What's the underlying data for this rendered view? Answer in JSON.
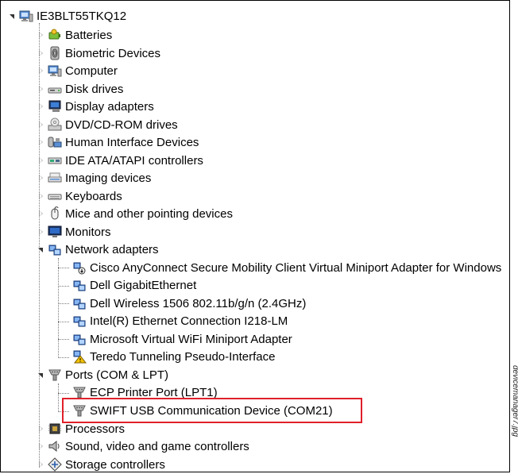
{
  "tree": {
    "root": {
      "label": "IE3BLT55TKQ12",
      "icon": "computer-icon",
      "expanded": true
    },
    "categories": [
      {
        "label": "Batteries",
        "icon": "battery-icon",
        "expanded": false
      },
      {
        "label": "Biometric Devices",
        "icon": "fingerprint-icon",
        "expanded": false
      },
      {
        "label": "Computer",
        "icon": "computer-icon",
        "expanded": false
      },
      {
        "label": "Disk drives",
        "icon": "disk-drive-icon",
        "expanded": false
      },
      {
        "label": "Display adapters",
        "icon": "display-adapter-icon",
        "expanded": false
      },
      {
        "label": "DVD/CD-ROM drives",
        "icon": "dvd-drive-icon",
        "expanded": false
      },
      {
        "label": "Human Interface Devices",
        "icon": "hid-icon",
        "expanded": false
      },
      {
        "label": "IDE ATA/ATAPI controllers",
        "icon": "ide-controller-icon",
        "expanded": false
      },
      {
        "label": "Imaging devices",
        "icon": "scanner-icon",
        "expanded": false
      },
      {
        "label": "Keyboards",
        "icon": "keyboard-icon",
        "expanded": false
      },
      {
        "label": "Mice and other pointing devices",
        "icon": "mouse-icon",
        "expanded": false
      },
      {
        "label": "Monitors",
        "icon": "monitor-icon",
        "expanded": false
      },
      {
        "label": "Network adapters",
        "icon": "network-adapter-icon",
        "expanded": true
      },
      {
        "label": "Ports (COM & LPT)",
        "icon": "port-icon",
        "expanded": true
      },
      {
        "label": "Processors",
        "icon": "processor-icon",
        "expanded": false
      },
      {
        "label": "Sound, video and game controllers",
        "icon": "speaker-icon",
        "expanded": false
      },
      {
        "label": "Storage controllers",
        "icon": "storage-controller-icon",
        "expanded": false
      }
    ],
    "network_adapters": [
      {
        "label": "Cisco AnyConnect Secure Mobility Client Virtual Miniport Adapter for Windows",
        "icon": "network-adapter-disabled-icon"
      },
      {
        "label": "Dell GigabitEthernet",
        "icon": "network-adapter-icon"
      },
      {
        "label": "Dell Wireless 1506 802.11b/g/n (2.4GHz)",
        "icon": "network-adapter-icon"
      },
      {
        "label": "Intel(R) Ethernet Connection I218-LM",
        "icon": "network-adapter-icon"
      },
      {
        "label": "Microsoft Virtual WiFi Miniport Adapter",
        "icon": "network-adapter-icon"
      },
      {
        "label": "Teredo Tunneling Pseudo-Interface",
        "icon": "network-adapter-warning-icon"
      }
    ],
    "ports": [
      {
        "label": "ECP Printer Port (LPT1)",
        "icon": "port-icon"
      },
      {
        "label": "SWIFT USB Communication Device (COM21)",
        "icon": "port-icon"
      }
    ]
  },
  "caption": "devicemanager7.jpg",
  "colors": {
    "highlight": "#e0202a",
    "text": "#000000",
    "guide": "#7a7a7a"
  }
}
